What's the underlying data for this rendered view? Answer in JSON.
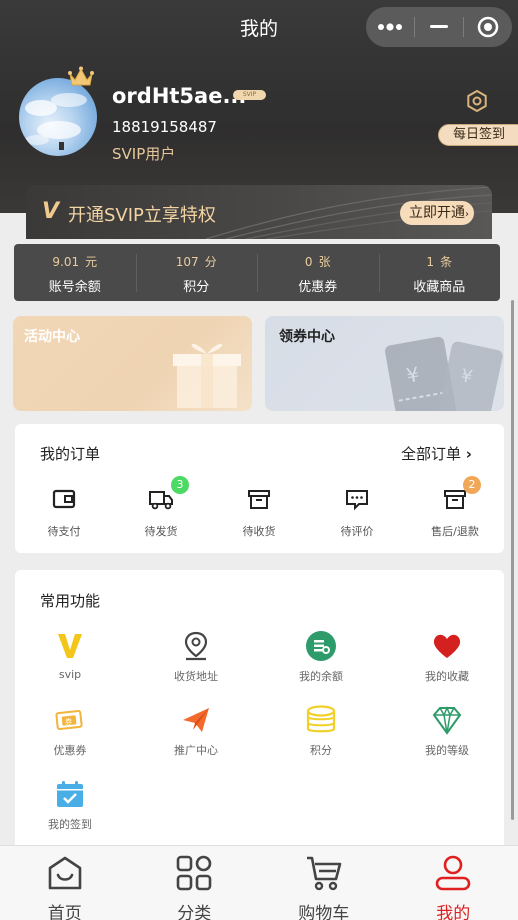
{
  "navbar": {
    "title": "我的"
  },
  "profile": {
    "username": "ordHt5ae...",
    "vip_tag": "SVIP",
    "phone": "18819158487",
    "level": "SVIP用户",
    "signin_label": "每日签到"
  },
  "svip_banner": {
    "icon": "V",
    "text": "开通SVIP立享特权",
    "button": "立即开通"
  },
  "stats": [
    {
      "value": "9.01",
      "unit": "元",
      "label": "账号余额"
    },
    {
      "value": "107",
      "unit": "分",
      "label": "积分"
    },
    {
      "value": "0",
      "unit": "张",
      "label": "优惠券"
    },
    {
      "value": "1",
      "unit": "条",
      "label": "收藏商品"
    }
  ],
  "cards": {
    "activity": "活动中心",
    "coupon": "领券中心"
  },
  "orders": {
    "title": "我的订单",
    "all_label": "全部订单",
    "items": [
      {
        "label": "待支付",
        "icon": "wallet-icon"
      },
      {
        "label": "待发货",
        "icon": "truck-icon",
        "badge": "3",
        "badge_color": "#4cd964"
      },
      {
        "label": "待收货",
        "icon": "box-icon"
      },
      {
        "label": "待评价",
        "icon": "comment-icon"
      },
      {
        "label": "售后/退款",
        "icon": "refund-icon",
        "badge": "2",
        "badge_color": "#f0a858"
      }
    ]
  },
  "functions": {
    "title": "常用功能",
    "items": [
      {
        "label": "svip",
        "icon": "svip-v-icon"
      },
      {
        "label": "收货地址",
        "icon": "location-pin-icon"
      },
      {
        "label": "我的余额",
        "icon": "coins-icon"
      },
      {
        "label": "我的收藏",
        "icon": "heart-icon"
      },
      {
        "label": "优惠券",
        "icon": "coupon-icon"
      },
      {
        "label": "推广中心",
        "icon": "paper-plane-icon"
      },
      {
        "label": "积分",
        "icon": "database-icon"
      },
      {
        "label": "我的等级",
        "icon": "diamond-icon"
      },
      {
        "label": "我的签到",
        "icon": "calendar-check-icon"
      }
    ]
  },
  "tabbar": [
    {
      "label": "首页",
      "icon": "home-icon"
    },
    {
      "label": "分类",
      "icon": "grid-icon"
    },
    {
      "label": "购物车",
      "icon": "cart-icon"
    },
    {
      "label": "我的",
      "icon": "user-icon",
      "active": true
    }
  ],
  "colors": {
    "accent": "#e02020",
    "gold": "#e7c89b",
    "header_bg": "#333333"
  }
}
